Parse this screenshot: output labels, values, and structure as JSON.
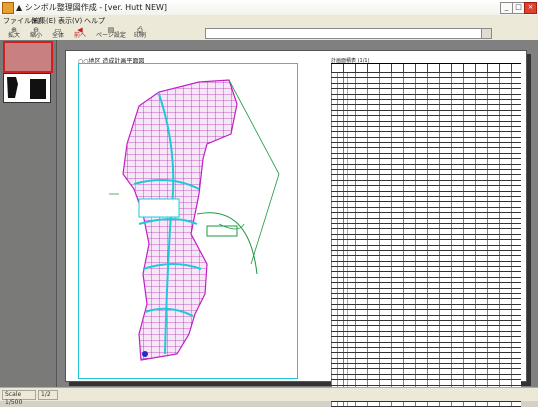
{
  "window": {
    "title": "▲ シンボル整理図作成 - [ver. Hutt NEW]",
    "buttons": {
      "minimize": "_",
      "maximize": "□",
      "close": "×"
    }
  },
  "menu": {
    "items": [
      "ファイル(F)",
      "編集(E)",
      "表示(V)",
      "ヘルプ"
    ]
  },
  "toolbar": {
    "buttons": [
      {
        "label": "拡大",
        "icon": "zoom-in-icon",
        "glyph": "⊕"
      },
      {
        "label": "縮小",
        "icon": "zoom-out-icon",
        "glyph": "⊖"
      },
      {
        "label": "全体",
        "icon": "fit-page-icon",
        "glyph": "▭"
      },
      {
        "label": "前へ",
        "icon": "prev-page-icon",
        "glyph": "◀"
      },
      {
        "label": "ページ設定",
        "icon": "page-setup-icon",
        "glyph": "▤"
      },
      {
        "label": "印刷",
        "icon": "print-icon",
        "glyph": "⎙"
      }
    ],
    "address_value": ""
  },
  "page": {
    "caption": "○○地区 造成計画平面図",
    "table_caption": "計画面積表 (1/1)"
  },
  "status": {
    "left": "Scale 1/500",
    "right": "1/2"
  },
  "colors": {
    "map_line": "#c020c0",
    "frame": "#20c8d8",
    "road": "#1a9a40",
    "accent": "#d02020"
  }
}
